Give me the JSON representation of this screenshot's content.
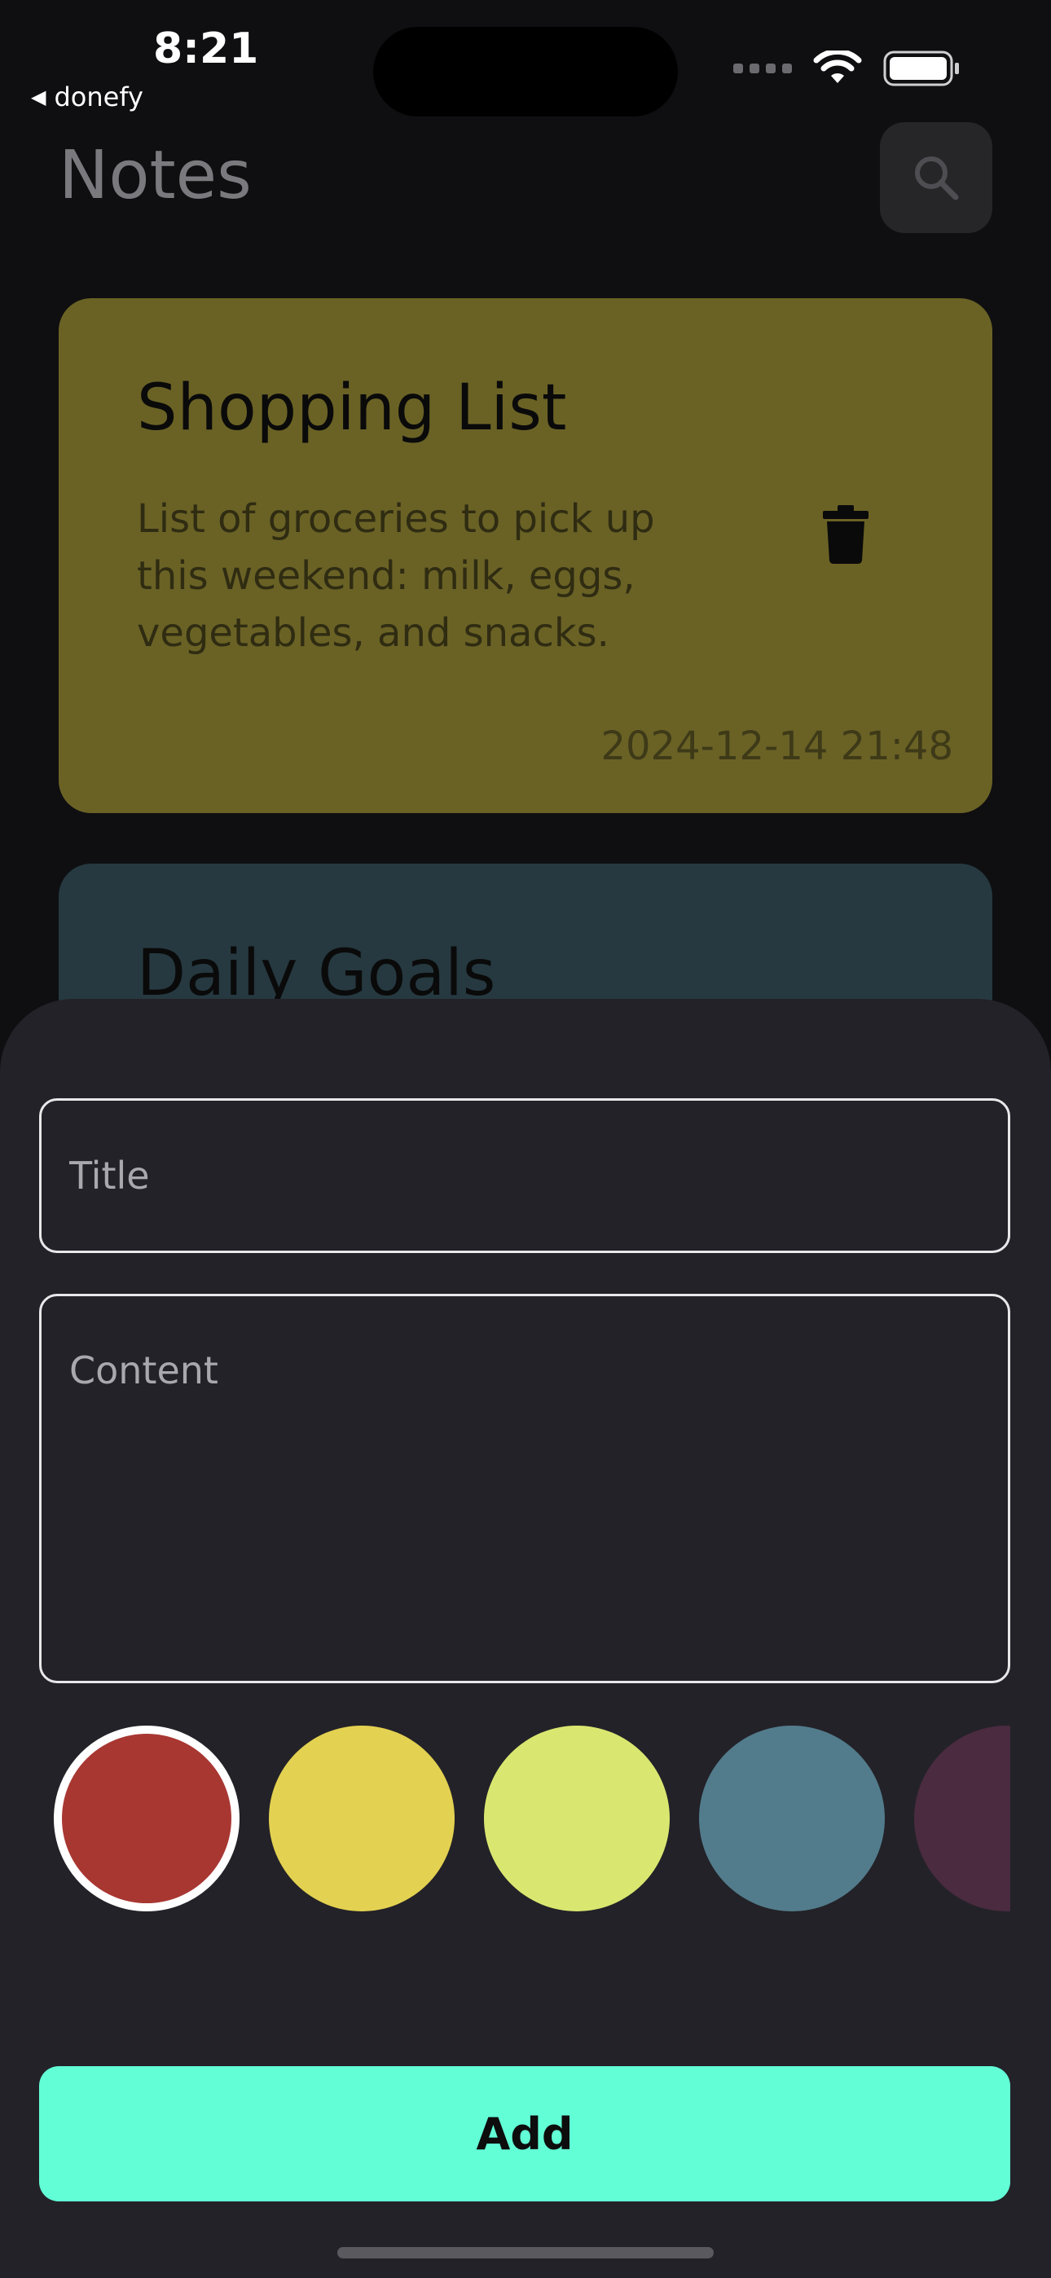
{
  "status_bar": {
    "time": "8:21",
    "back_app": "donefy"
  },
  "header": {
    "title": "Notes",
    "search_icon": "search-icon"
  },
  "notes": [
    {
      "title": "Shopping List",
      "content": "List of groceries to pick up this weekend: milk, eggs, vegetables, and snacks.",
      "date": "2024-12-14 21:48",
      "color": "#6a6225",
      "delete_icon": "trash-icon"
    },
    {
      "title": "Daily Goals",
      "color": "#263940"
    }
  ],
  "sheet": {
    "title_placeholder": "Title",
    "content_placeholder": "Content",
    "add_label": "Add",
    "colors": [
      "#a83732",
      "#e3d151",
      "#d9e770",
      "#527c8c",
      "#4a2b40"
    ],
    "selected_color_index": 0
  }
}
